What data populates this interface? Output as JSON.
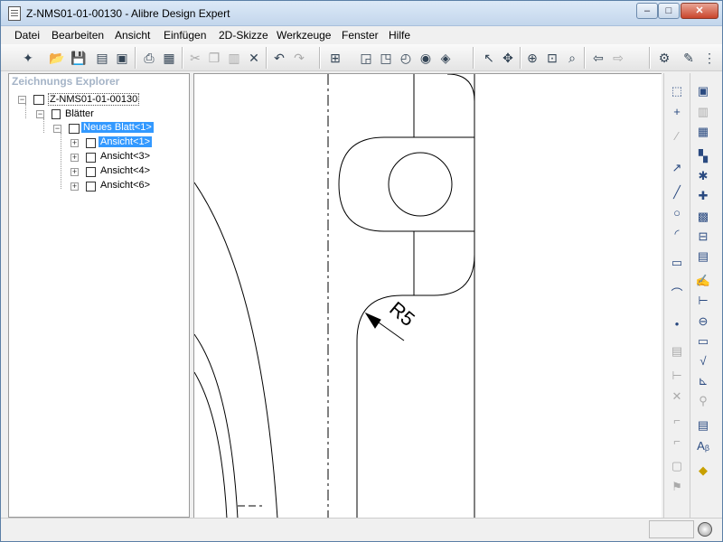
{
  "window": {
    "title": "Z-NMS01-01-00130 - Alibre Design Expert",
    "min_label": "–",
    "max_label": "□",
    "close_label": "✕"
  },
  "menu": [
    "Datei",
    "Bearbeiten",
    "Ansicht",
    "Einfügen",
    "2D-Skizze",
    "Werkzeuge",
    "Fenster",
    "Hilfe"
  ],
  "explorer": {
    "title": "Zeichnungs Explorer",
    "root": "Z-NMS01-01-00130",
    "sheets": "Blätter",
    "sheet": "Neues Blatt<1>",
    "views": [
      "Ansicht<1>",
      "Ansicht<3>",
      "Ansicht<4>",
      "Ansicht<6>"
    ]
  },
  "drawing": {
    "dimension_label": "R5"
  },
  "toolbar_icons": [
    "new-icon",
    "open-icon",
    "save-icon",
    "print-setup-icon",
    "copy-format-icon",
    "print-icon",
    "preview-icon",
    "cut-icon",
    "copy-icon",
    "paste-icon",
    "delete-icon",
    "undo-icon",
    "redo-icon",
    "sheet-icon",
    "view-icon",
    "section-icon",
    "detail-icon",
    "broken-view-icon",
    "hide-icon",
    "select-icon",
    "pan-icon",
    "zoom-in-icon",
    "zoom-window-icon",
    "zoom-fit-icon",
    "back-icon",
    "forward-icon",
    "model-view-icon",
    "dimension-icon"
  ],
  "colors": {
    "selection": "#3399ff",
    "explorer_title": "#a5b4c7"
  }
}
